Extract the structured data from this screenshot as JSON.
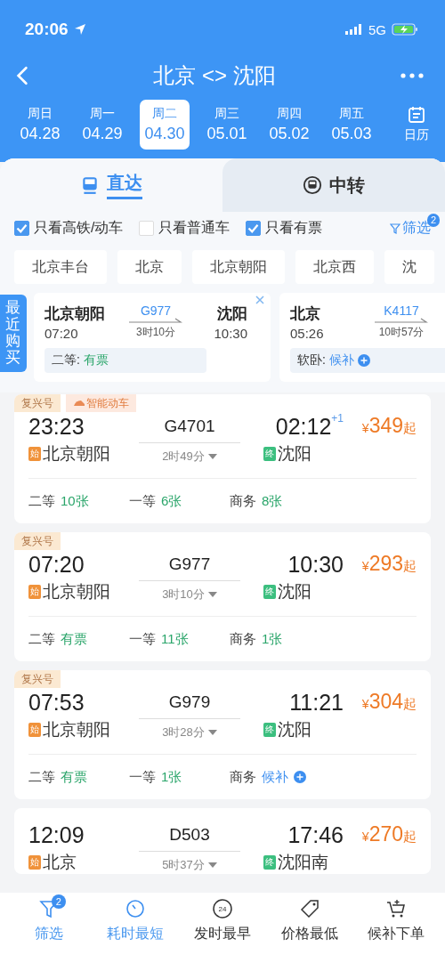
{
  "status_bar": {
    "time": "20:06",
    "network": "5G"
  },
  "nav": {
    "title": "北京 <> 沈阳"
  },
  "dates": [
    {
      "weekday": "周日",
      "date": "04.28",
      "selected": false
    },
    {
      "weekday": "周一",
      "date": "04.29",
      "selected": false
    },
    {
      "weekday": "周二",
      "date": "04.30",
      "selected": true
    },
    {
      "weekday": "周三",
      "date": "05.01",
      "selected": false
    },
    {
      "weekday": "周四",
      "date": "05.02",
      "selected": false
    },
    {
      "weekday": "周五",
      "date": "05.03",
      "selected": false
    }
  ],
  "calendar_label": "日历",
  "tabs": [
    {
      "label": "直达",
      "selected": true,
      "kind": "direct"
    },
    {
      "label": "中转",
      "selected": false,
      "kind": "transfer"
    }
  ],
  "filters": [
    {
      "label": "只看高铁/动车",
      "checked": true
    },
    {
      "label": "只看普通车",
      "checked": false
    },
    {
      "label": "只看有票",
      "checked": true
    }
  ],
  "filter_button": {
    "label": "筛选",
    "badge": "2"
  },
  "stations": [
    "北京丰台",
    "北京",
    "北京朝阳",
    "北京西",
    "沈"
  ],
  "recent": {
    "label": "最近购买",
    "trips": [
      {
        "from": "北京朝阳",
        "depart": "07:20",
        "train": "G977",
        "duration": "3时10分",
        "to": "沈阳",
        "arrive": "10:30",
        "seat": "二等:",
        "status": "有票",
        "kind": "available",
        "closable": true
      },
      {
        "from": "北京",
        "depart": "05:26",
        "train": "K4117",
        "duration": "10时57分",
        "seat": "软卧:",
        "status": "候补",
        "kind": "waitlist"
      }
    ]
  },
  "trains": [
    {
      "tags": [
        {
          "label": "复兴号",
          "kind": "brand"
        },
        {
          "label": "智能动车",
          "kind": "smart"
        }
      ],
      "depart": "23:23",
      "train": "G4701",
      "duration": "2时49分",
      "arrive": "02:12",
      "next_day": "+1",
      "currency": "¥",
      "price": "349",
      "suffix": "起",
      "from_badge": "始",
      "from": "北京朝阳",
      "to_badge": "终",
      "to": "沈阳",
      "seats": [
        {
          "class": "二等",
          "status": "10张",
          "kind": "available"
        },
        {
          "class": "一等",
          "status": "6张",
          "kind": "available"
        },
        {
          "class": "商务",
          "status": "8张",
          "kind": "available"
        }
      ]
    },
    {
      "tags": [
        {
          "label": "复兴号",
          "kind": "brand"
        }
      ],
      "depart": "07:20",
      "train": "G977",
      "duration": "3时10分",
      "arrive": "10:30",
      "currency": "¥",
      "price": "293",
      "suffix": "起",
      "from_badge": "始",
      "from": "北京朝阳",
      "to_badge": "终",
      "to": "沈阳",
      "seats": [
        {
          "class": "二等",
          "status": "有票",
          "kind": "available"
        },
        {
          "class": "一等",
          "status": "11张",
          "kind": "available"
        },
        {
          "class": "商务",
          "status": "1张",
          "kind": "available"
        }
      ]
    },
    {
      "tags": [
        {
          "label": "复兴号",
          "kind": "brand"
        }
      ],
      "depart": "07:53",
      "train": "G979",
      "duration": "3时28分",
      "arrive": "11:21",
      "currency": "¥",
      "price": "304",
      "suffix": "起",
      "from_badge": "始",
      "from": "北京朝阳",
      "to_badge": "终",
      "to": "沈阳",
      "seats": [
        {
          "class": "二等",
          "status": "有票",
          "kind": "available"
        },
        {
          "class": "一等",
          "status": "1张",
          "kind": "available"
        },
        {
          "class": "商务",
          "status": "候补",
          "kind": "waitlist"
        }
      ]
    },
    {
      "depart": "12:09",
      "train": "D503",
      "duration": "5时37分",
      "arrive": "17:46",
      "currency": "¥",
      "price": "270",
      "suffix": "起",
      "from_badge": "始",
      "from": "北京",
      "to_badge": "终",
      "to": "沈阳南"
    }
  ],
  "bottom_bar": [
    {
      "label": "筛选",
      "selected": true,
      "kind": "filter",
      "badge": "2"
    },
    {
      "label": "耗时最短",
      "selected": true,
      "kind": "duration"
    },
    {
      "label": "发时最早",
      "selected": false,
      "kind": "earliest",
      "icon_text": "24"
    },
    {
      "label": "价格最低",
      "selected": false,
      "kind": "price"
    },
    {
      "label": "候补下单",
      "selected": false,
      "kind": "waitlist"
    }
  ]
}
